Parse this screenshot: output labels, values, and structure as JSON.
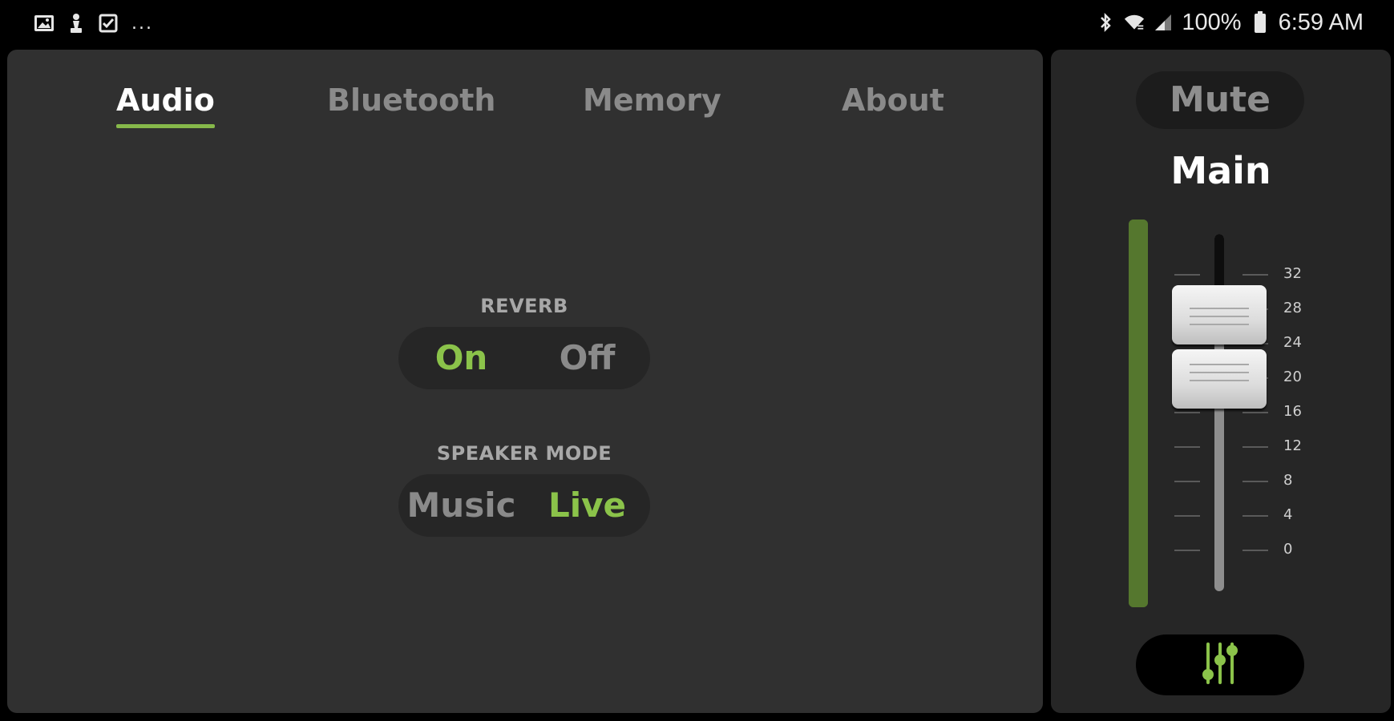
{
  "status_bar": {
    "notif_icons": [
      "gallery-icon",
      "chess-pawn-icon",
      "checkbox-icon"
    ],
    "more": "...",
    "battery_pct": "100%",
    "time": "6:59 AM",
    "icons_right": [
      "bluetooth-icon",
      "wifi-icon",
      "signal-icon",
      "battery-icon"
    ]
  },
  "tabs": [
    {
      "label": "Audio",
      "active": true
    },
    {
      "label": "Bluetooth",
      "active": false
    },
    {
      "label": "Memory",
      "active": false
    },
    {
      "label": "About",
      "active": false
    }
  ],
  "audio": {
    "reverb": {
      "label": "REVERB",
      "options": [
        "On",
        "Off"
      ],
      "selected": "On"
    },
    "speaker_mode": {
      "label": "SPEAKER MODE",
      "options": [
        "Music",
        "Live"
      ],
      "selected": "Live"
    }
  },
  "side": {
    "mute_label": "Mute",
    "channel_label": "Main",
    "fader_scale": [
      "32",
      "28",
      "24",
      "20",
      "16",
      "12",
      "8",
      "4",
      "0"
    ],
    "meter_level": 1.0,
    "mixer_icon": "mixer-sliders-icon"
  },
  "colors": {
    "accent": "#8bc34a",
    "panel": "#303030",
    "side_panel": "#262626",
    "meter": "#55772e"
  }
}
